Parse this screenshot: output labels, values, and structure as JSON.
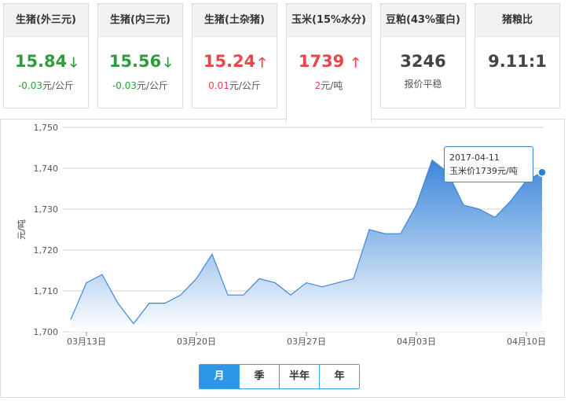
{
  "cards": [
    {
      "title": "生猪(外三元)",
      "value": "15.84",
      "trend": "down",
      "change": "-0.03",
      "unit": "元/公斤"
    },
    {
      "title": "生猪(内三元)",
      "value": "15.56",
      "trend": "down",
      "change": "-0.03",
      "unit": "元/公斤"
    },
    {
      "title": "生猪(土杂猪)",
      "value": "15.24",
      "trend": "up",
      "change": "0.01",
      "unit": "元/公斤"
    },
    {
      "title": "玉米(15%水分)",
      "value": "1739",
      "trend": "up",
      "change": "2",
      "unit": "元/吨",
      "active": true
    },
    {
      "title": "豆粕(43%蛋白)",
      "value": "3246",
      "trend": "none",
      "change": "",
      "unit": "报价平稳"
    },
    {
      "title": "猪粮比",
      "value": "9.11:1",
      "trend": "none",
      "change": "",
      "unit": ""
    }
  ],
  "chart_data": {
    "type": "area",
    "ylabel": "元/吨",
    "ylim": [
      1700,
      1750
    ],
    "yticks": [
      1700,
      1710,
      1720,
      1730,
      1740,
      1750
    ],
    "ytick_labels": [
      "1,700",
      "1,710",
      "1,720",
      "1,730",
      "1,740",
      "1,750"
    ],
    "x_tick_labels": [
      {
        "label": "03月13日",
        "index": 1
      },
      {
        "label": "03月20日",
        "index": 8
      },
      {
        "label": "03月27日",
        "index": 15
      },
      {
        "label": "04月03日",
        "index": 22
      },
      {
        "label": "04月10日",
        "index": 29
      }
    ],
    "dates": [
      "2017-03-12",
      "2017-03-13",
      "2017-03-14",
      "2017-03-15",
      "2017-03-16",
      "2017-03-17",
      "2017-03-18",
      "2017-03-19",
      "2017-03-20",
      "2017-03-21",
      "2017-03-22",
      "2017-03-23",
      "2017-03-24",
      "2017-03-25",
      "2017-03-26",
      "2017-03-27",
      "2017-03-28",
      "2017-03-29",
      "2017-03-30",
      "2017-03-31",
      "2017-04-01",
      "2017-04-02",
      "2017-04-03",
      "2017-04-04",
      "2017-04-05",
      "2017-04-06",
      "2017-04-07",
      "2017-04-08",
      "2017-04-09",
      "2017-04-10",
      "2017-04-11"
    ],
    "values": [
      1703,
      1712,
      1714,
      1707,
      1702,
      1707,
      1707,
      1709,
      1713,
      1719,
      1709,
      1709,
      1713,
      1712,
      1709,
      1712,
      1711,
      1712,
      1713,
      1725,
      1724,
      1724,
      1731,
      1742,
      1739,
      1731,
      1730,
      1728,
      1732,
      1737,
      1739
    ],
    "grid": true,
    "colors": {
      "line": "#3d87d9",
      "fill_top": "#3d87d9",
      "fill_bottom": "#ffffff",
      "grid": "#d0d0d0",
      "point": "#2b7fd9"
    },
    "highlight_index": 30,
    "tooltip": {
      "date": "2017-04-11",
      "text": "玉米价1739元/吨"
    }
  },
  "range_buttons": [
    {
      "label": "月",
      "active": true
    },
    {
      "label": "季",
      "active": false
    },
    {
      "label": "半年",
      "active": false
    },
    {
      "label": "年",
      "active": false
    }
  ]
}
